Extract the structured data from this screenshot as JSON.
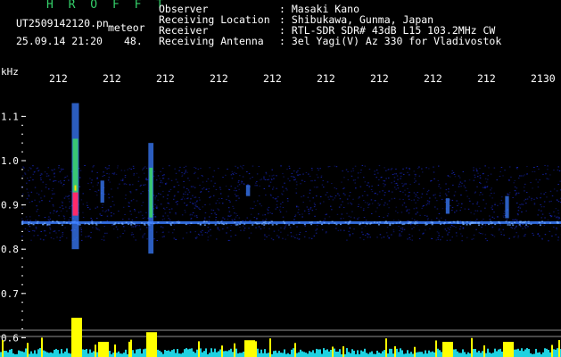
{
  "header": {
    "title": "H R O F F T",
    "filename": "UT2509142120.pn",
    "meteor_label": "meteor",
    "datetime": "25.09.14 21:20",
    "counter": "48.",
    "info_labels": [
      "Observer",
      "Receiving Location",
      "Receiver",
      "Receiving Antenna"
    ],
    "info_values": [
      ": Masaki Kano",
      ": Shibukawa, Gunma, Japan",
      ": RTL-SDR SDR# 43dB L15 103.2MHz CW",
      ": 3el Yagi(V) Az 330 for Vladivostok"
    ]
  },
  "colors": {
    "text": "#ffffff",
    "title": "#34d06a",
    "background": "#000000",
    "noise": "#1a2bd0",
    "carrier": "#3a7cff",
    "echo_core": "#ff2a6a",
    "echo_mid": "#3ad16a",
    "echo_edge": "#ffe000",
    "baseline": "#c0c0c0",
    "histogram": "#1fd2e0",
    "histogram_peak": "#ffff00"
  },
  "chart_data": {
    "type": "heatmap",
    "title": "",
    "ylabel": "kHz",
    "y_ticks": [
      "1.1",
      "1.0",
      "0.9",
      "0.8",
      "0.7",
      "0.6"
    ],
    "ylim": [
      0.58,
      1.16
    ],
    "x_tick_labels": [
      "212",
      "212",
      "212",
      "212",
      "212",
      "212",
      "212",
      "212",
      "212",
      "2130"
    ],
    "carrier_khz": 0.86,
    "noise_band_khz": [
      0.82,
      0.99
    ],
    "meteor_echoes": [
      {
        "time_frac": 0.1,
        "f_center": 0.9,
        "f_low": 0.8,
        "f_high": 1.13,
        "strength": 1.0
      },
      {
        "time_frac": 0.24,
        "f_center": 0.88,
        "f_low": 0.79,
        "f_high": 1.04,
        "strength": 0.55
      },
      {
        "time_frac": 0.15,
        "f_center": 0.925,
        "f_low": 0.905,
        "f_high": 0.955,
        "strength": 0.25
      },
      {
        "time_frac": 0.42,
        "f_center": 0.935,
        "f_low": 0.92,
        "f_high": 0.945,
        "strength": 0.3
      },
      {
        "time_frac": 0.79,
        "f_center": 0.9,
        "f_low": 0.88,
        "f_high": 0.915,
        "strength": 0.25
      },
      {
        "time_frac": 0.9,
        "f_center": 0.89,
        "f_low": 0.87,
        "f_high": 0.92,
        "strength": 0.25
      }
    ]
  }
}
